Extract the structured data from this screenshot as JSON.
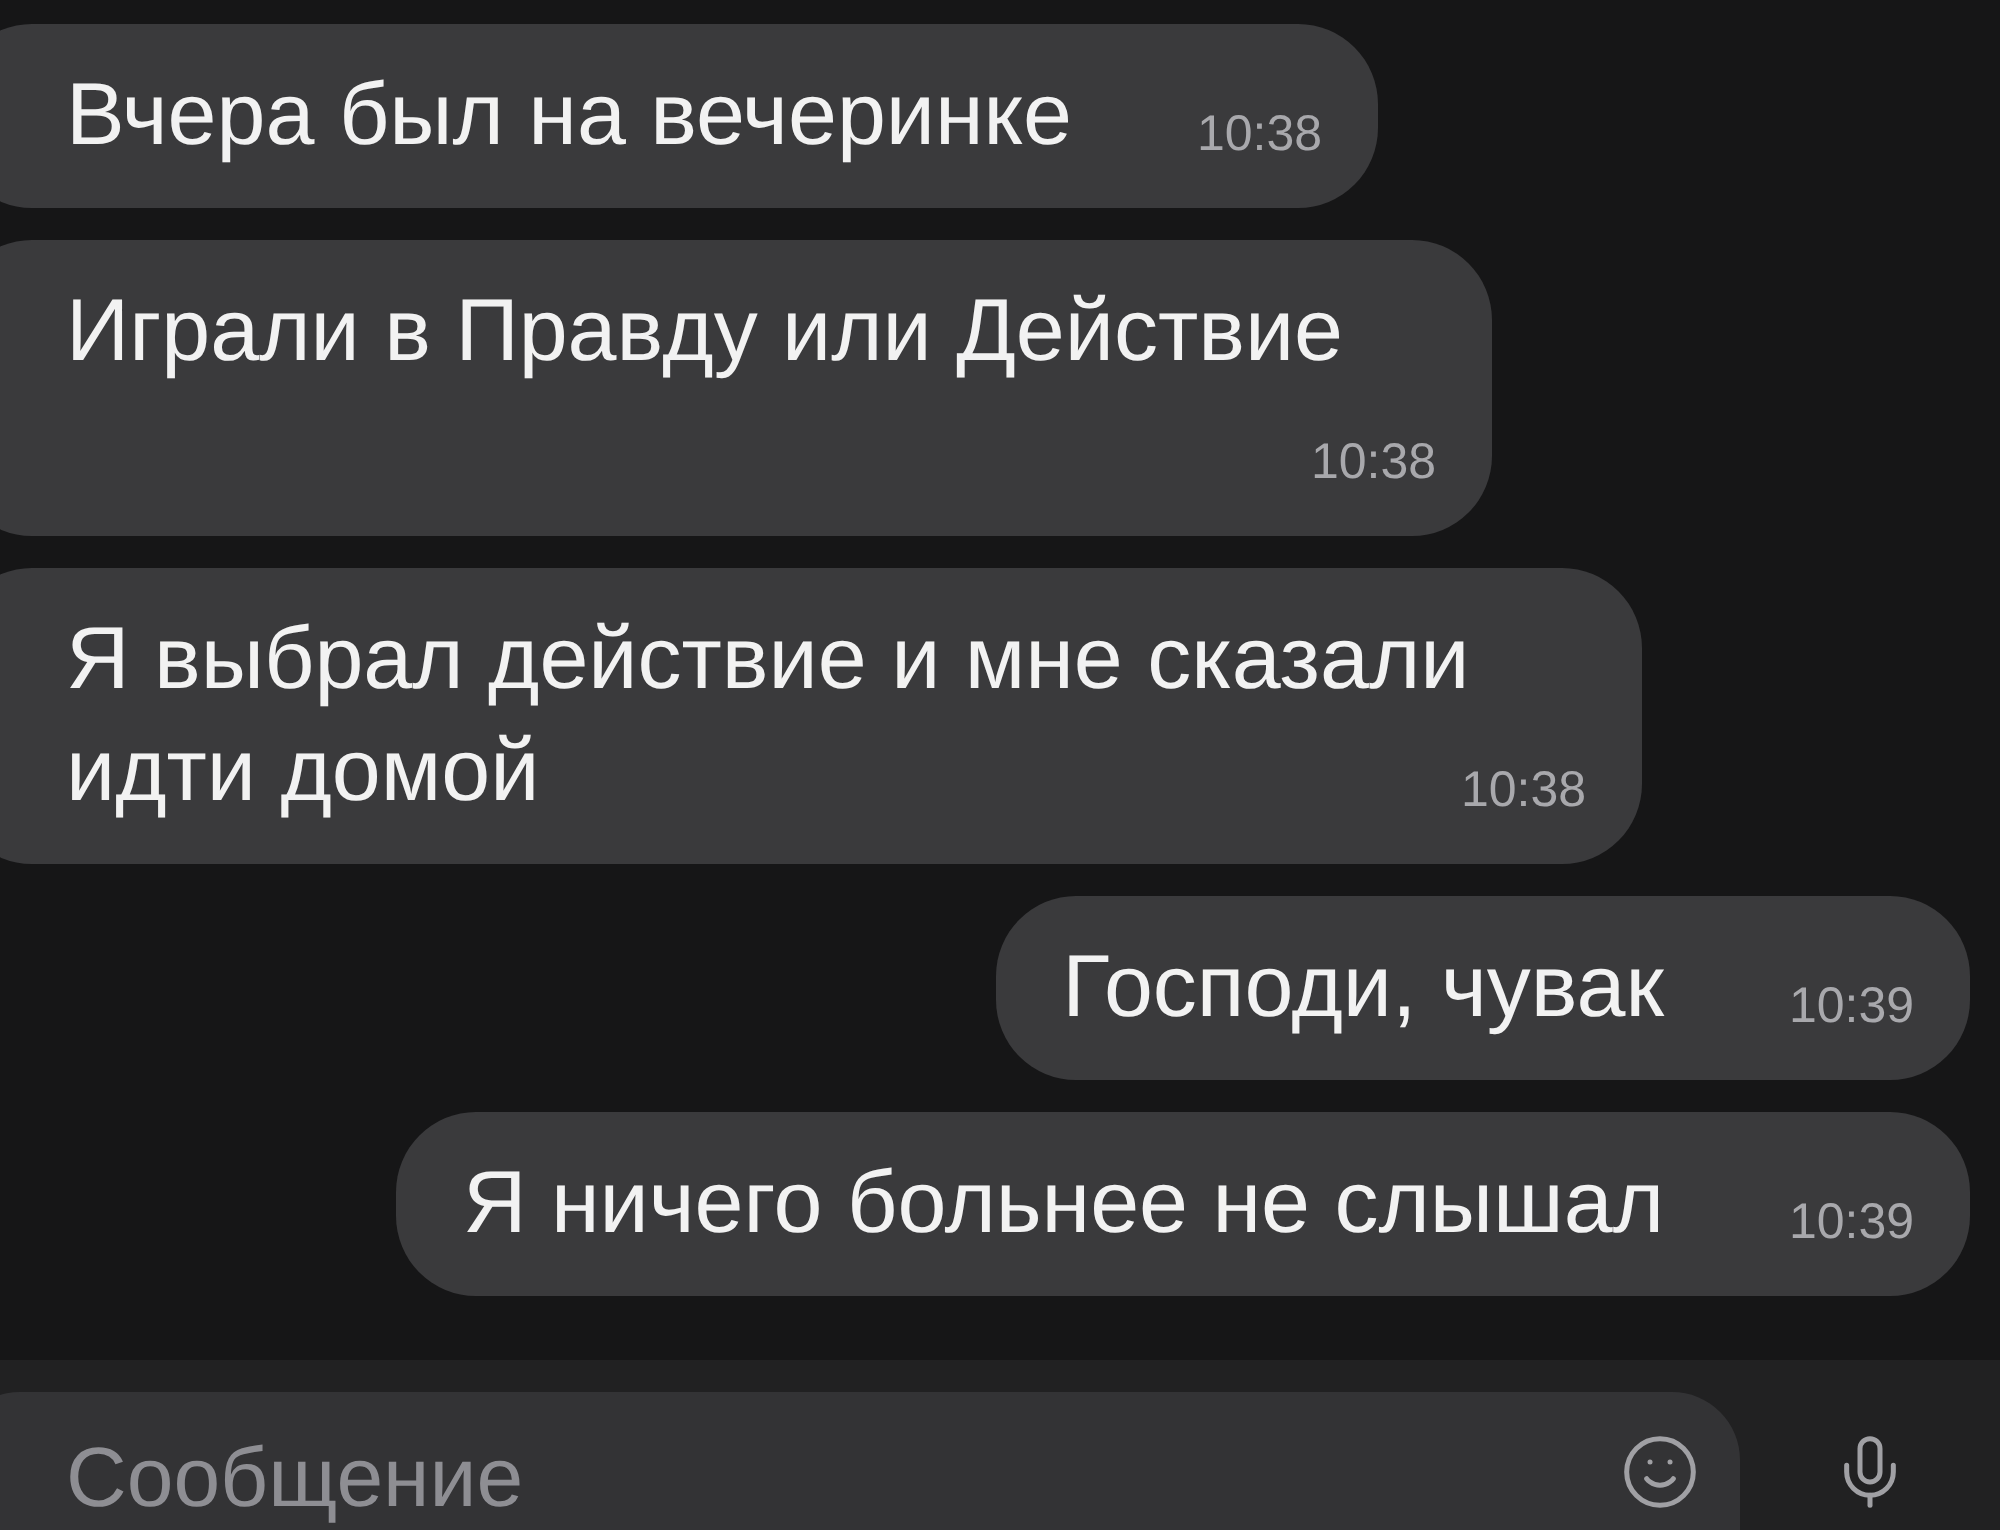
{
  "messages": [
    {
      "kind": "incoming",
      "text": "Вчера был на вечеринке",
      "time": "10:38"
    },
    {
      "kind": "incoming",
      "text": "Играли в Правду или Действие",
      "time": "10:38"
    },
    {
      "kind": "incoming",
      "text": "Я выбрал действие и мне сказали идти домой",
      "time": "10:38"
    },
    {
      "kind": "outgoing",
      "text": "Господи, чувак",
      "time": "10:39"
    },
    {
      "kind": "outgoing",
      "text": "Я ничего больнее не слышал",
      "time": "10:39"
    }
  ],
  "composer": {
    "placeholder": "Сообщение"
  }
}
